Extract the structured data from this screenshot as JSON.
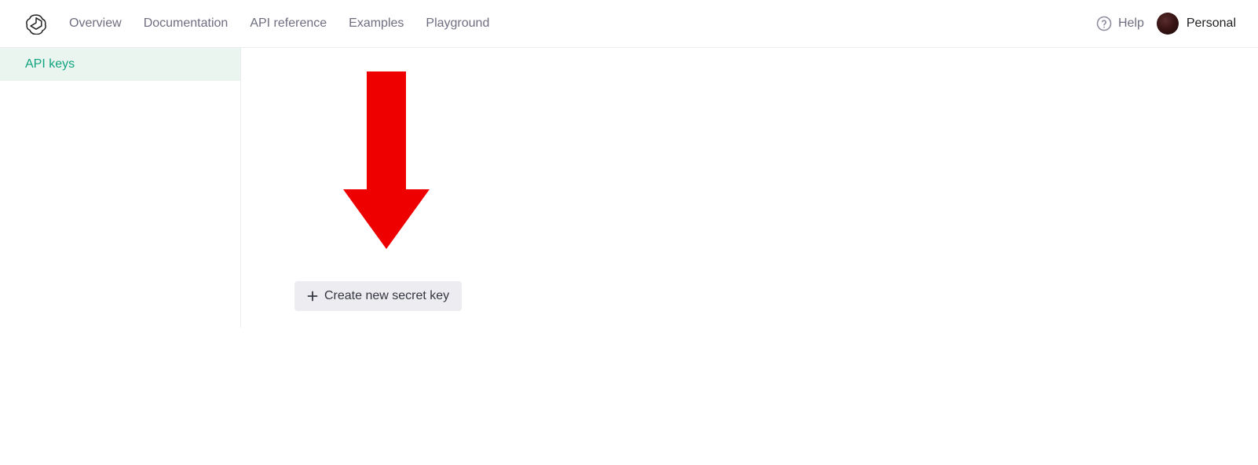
{
  "nav": {
    "links": [
      "Overview",
      "Documentation",
      "API reference",
      "Examples",
      "Playground"
    ],
    "help_label": "Help",
    "account_label": "Personal"
  },
  "sidebar": {
    "items": [
      {
        "label": "API keys",
        "active": true
      }
    ]
  },
  "main": {
    "create_key_label": "Create new secret key"
  },
  "annotation": {
    "arrow_color": "#ef0000"
  }
}
